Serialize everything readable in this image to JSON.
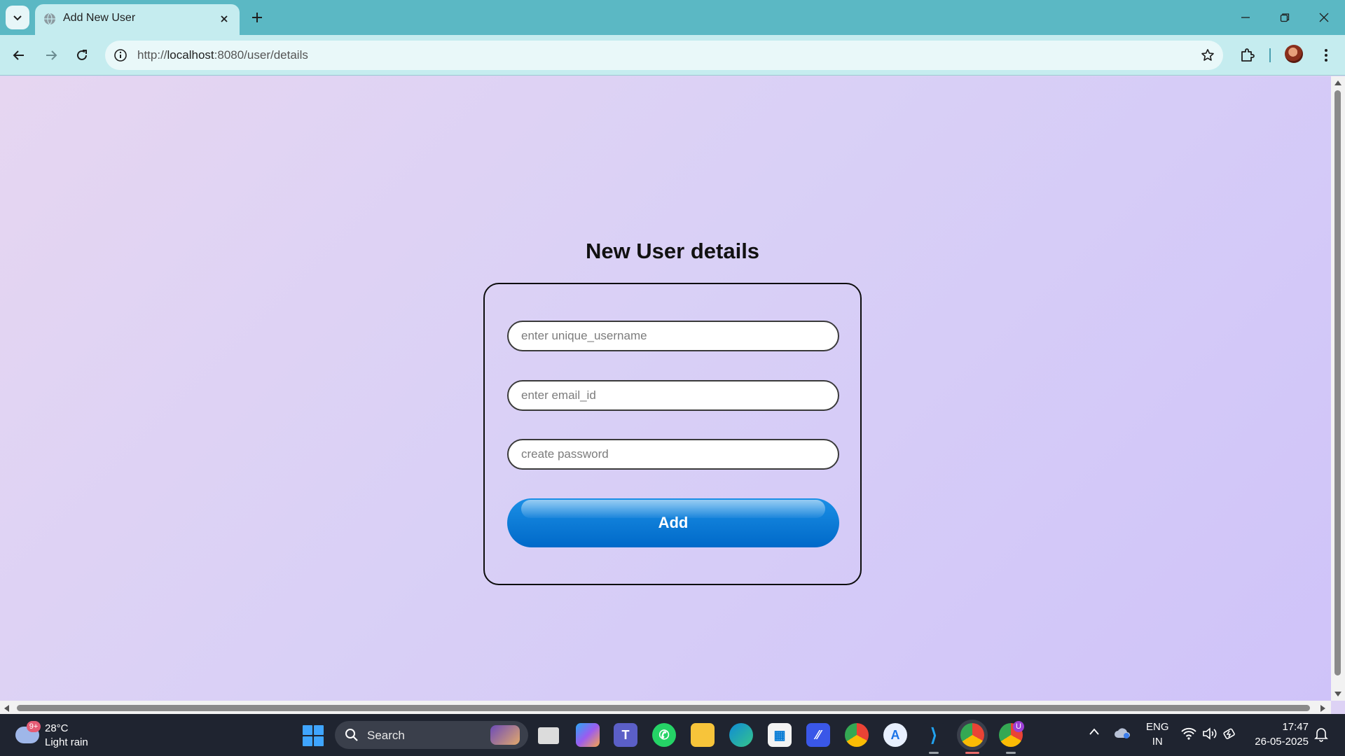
{
  "browser": {
    "tab_title": "Add New User",
    "url_scheme": "http://",
    "url_host": "localhost",
    "url_rest": ":8080/user/details"
  },
  "page": {
    "heading": "New User details",
    "username_placeholder": "enter unique_username",
    "email_placeholder": "enter email_id",
    "password_placeholder": "create password",
    "add_label": "Add"
  },
  "taskbar": {
    "weather_badge": "9+",
    "temperature": "28°C",
    "condition": "Light rain",
    "search_label": "Search",
    "lang_top": "ENG",
    "lang_bottom": "IN",
    "time": "17:47",
    "date": "26-05-2025",
    "profile_badge": "U"
  },
  "colors": {
    "tabstrip": "#5bb8c4",
    "toolbar": "#c5ecef",
    "page_gradient_start": "#e6d6f1",
    "page_gradient_end": "#cfc3f9",
    "add_button": "#0f7ed8",
    "taskbar": "#1f2430"
  }
}
